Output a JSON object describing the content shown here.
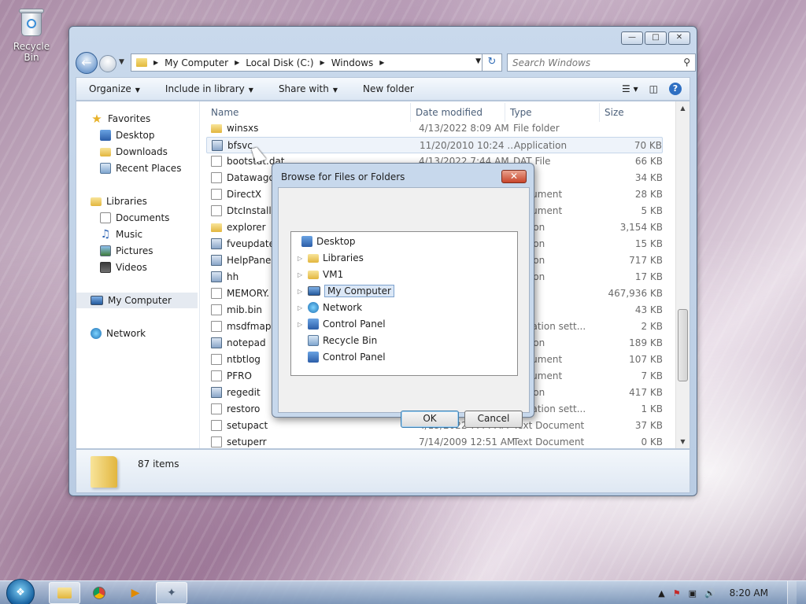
{
  "desktop": {
    "recycle_bin_label": "Recycle Bin"
  },
  "explorer": {
    "breadcrumb": [
      "My Computer",
      "Local Disk (C:)",
      "Windows"
    ],
    "search_placeholder": "Search Windows",
    "toolbar": {
      "organize": "Organize",
      "include_in_library": "Include in library",
      "share_with": "Share with",
      "new_folder": "New folder"
    },
    "nav": {
      "favorites": "Favorites",
      "desktop": "Desktop",
      "downloads": "Downloads",
      "recent_places": "Recent Places",
      "libraries": "Libraries",
      "documents": "Documents",
      "music": "Music",
      "pictures": "Pictures",
      "videos": "Videos",
      "my_computer": "My Computer",
      "network": "Network"
    },
    "columns": {
      "name": "Name",
      "date": "Date modified",
      "type": "Type",
      "size": "Size"
    },
    "files": [
      {
        "name": "winsxs",
        "date": "4/13/2022 8:09 AM",
        "type": "File folder",
        "size": "",
        "icon": "folder"
      },
      {
        "name": "bfsvc",
        "date": "11/20/2010 10:24 ...",
        "type": "Application",
        "size": "70 KB",
        "icon": "app"
      },
      {
        "name": "bootstat.dat",
        "date": "4/13/2022 7:44 AM",
        "type": "DAT File",
        "size": "66 KB",
        "icon": "file"
      },
      {
        "name": "Datawago",
        "date": "",
        "type": "",
        "size": "34 KB",
        "icon": "file"
      },
      {
        "name": "DirectX",
        "date": "",
        "type": "Document",
        "size": "28 KB",
        "icon": "file"
      },
      {
        "name": "DtcInstall",
        "date": "",
        "type": "Document",
        "size": "5 KB",
        "icon": "file"
      },
      {
        "name": "explorer",
        "date": "",
        "type": "ication",
        "size": "3,154 KB",
        "icon": "folder"
      },
      {
        "name": "fveupdate",
        "date": "",
        "type": "ication",
        "size": "15 KB",
        "icon": "app"
      },
      {
        "name": "HelpPane",
        "date": "",
        "type": "ication",
        "size": "717 KB",
        "icon": "app"
      },
      {
        "name": "hh",
        "date": "",
        "type": "ication",
        "size": "17 KB",
        "icon": "app"
      },
      {
        "name": "MEMORY.",
        "date": "",
        "type": "File",
        "size": "467,936 KB",
        "icon": "file"
      },
      {
        "name": "mib.bin",
        "date": "",
        "type": "ile",
        "size": "43 KB",
        "icon": "file"
      },
      {
        "name": "msdfmap",
        "date": "",
        "type": "iguration sett...",
        "size": "2 KB",
        "icon": "file"
      },
      {
        "name": "notepad",
        "date": "",
        "type": "ication",
        "size": "189 KB",
        "icon": "app"
      },
      {
        "name": "ntbtlog",
        "date": "",
        "type": "Document",
        "size": "107 KB",
        "icon": "file"
      },
      {
        "name": "PFRO",
        "date": "",
        "type": "Document",
        "size": "7 KB",
        "icon": "file"
      },
      {
        "name": "regedit",
        "date": "",
        "type": "ication",
        "size": "417 KB",
        "icon": "app"
      },
      {
        "name": "restoro",
        "date": "",
        "type": "iguration sett...",
        "size": "1 KB",
        "icon": "file"
      },
      {
        "name": "setupact",
        "date": "4/13/2022 7:44 AM",
        "type": "Text Document",
        "size": "37 KB",
        "icon": "file"
      },
      {
        "name": "setuperr",
        "date": "7/14/2009 12:51 AM",
        "type": "Text Document",
        "size": "0 KB",
        "icon": "file"
      }
    ],
    "status": {
      "items_count": "87 items"
    }
  },
  "dialog": {
    "title": "Browse for Files or Folders",
    "close_glyph": "✕",
    "tree": [
      {
        "label": "Desktop",
        "depth": 0,
        "expandable": false,
        "selected": false
      },
      {
        "label": "Libraries",
        "depth": 1,
        "expandable": true,
        "selected": false
      },
      {
        "label": "VM1",
        "depth": 1,
        "expandable": true,
        "selected": false
      },
      {
        "label": "My Computer",
        "depth": 1,
        "expandable": true,
        "selected": true
      },
      {
        "label": "Network",
        "depth": 1,
        "expandable": true,
        "selected": false
      },
      {
        "label": "Control Panel",
        "depth": 1,
        "expandable": true,
        "selected": false
      },
      {
        "label": "Recycle Bin",
        "depth": 1,
        "expandable": false,
        "selected": false
      },
      {
        "label": "Control Panel",
        "depth": 1,
        "expandable": false,
        "selected": false
      }
    ],
    "ok_label": "OK",
    "cancel_label": "Cancel"
  },
  "taskbar": {
    "clock": "8:20 AM"
  }
}
